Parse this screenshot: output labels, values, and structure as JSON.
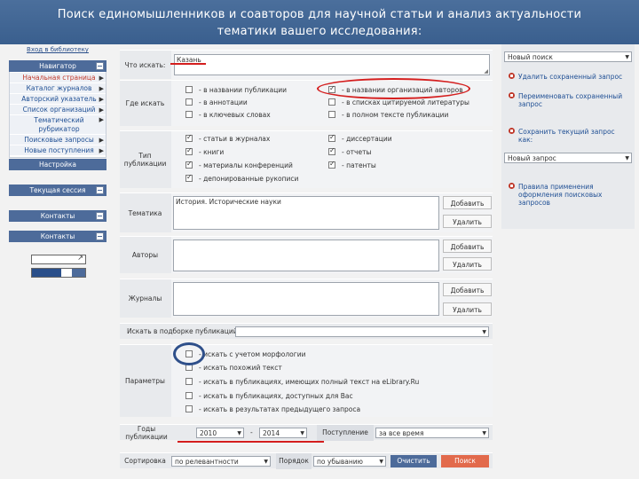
{
  "banner": {
    "line1": "Поиск единомышленников и соавторов для научной статьи и анализ актуальности",
    "line2": "тематики вашего исследования:"
  },
  "sidebar": {
    "top_link": "Вход в библиотеку",
    "nav_header": "Навигатор",
    "nav_items": [
      {
        "label": "Начальная страница"
      },
      {
        "label": "Каталог журналов"
      },
      {
        "label": "Авторский указатель"
      },
      {
        "label": "Список организаций"
      },
      {
        "label": "Тематический рубрикатор"
      },
      {
        "label": "Поисковые запросы"
      },
      {
        "label": "Новые поступления"
      }
    ],
    "settings": "Настройка",
    "panels": [
      "Текущая сессия",
      "Контакты",
      "Контакты"
    ]
  },
  "form": {
    "what": {
      "label": "Что искать:",
      "value": "Казань"
    },
    "where": {
      "label": "Где искать",
      "options": [
        {
          "label": "- в названии публикации",
          "checked": false
        },
        {
          "label": "- в аннотации",
          "checked": false
        },
        {
          "label": "- в ключевых словах",
          "checked": false
        },
        {
          "label": "- в названии организаций авторов",
          "checked": true
        },
        {
          "label": "- в списках цитируемой литературы",
          "checked": false
        },
        {
          "label": "- в полном тексте публикации",
          "checked": false
        }
      ]
    },
    "type": {
      "label": "Тип публикации",
      "options": [
        {
          "label": "- статьи в журналах",
          "checked": true
        },
        {
          "label": "- книги",
          "checked": true
        },
        {
          "label": "- материалы конференций",
          "checked": true
        },
        {
          "label": "- депонированные рукописи",
          "checked": true
        },
        {
          "label": "- диссертации",
          "checked": true
        },
        {
          "label": "- отчеты",
          "checked": true
        },
        {
          "label": "- патенты",
          "checked": true
        }
      ]
    },
    "topic": {
      "label": "Тематика",
      "value": "История. Исторические науки",
      "add": "Добавить",
      "remove": "Удалить"
    },
    "authors": {
      "label": "Авторы",
      "add": "Добавить",
      "remove": "Удалить"
    },
    "journal": {
      "label": "Журналы",
      "add": "Добавить",
      "remove": "Удалить"
    },
    "collection": {
      "label": "Искать в подборке публикаций"
    },
    "params": {
      "label": "Параметры",
      "options": [
        {
          "label": "- искать с учетом морфологии",
          "checked": false
        },
        {
          "label": "- искать похожий текст",
          "checked": false
        },
        {
          "label": "- искать в публикациях, имеющих полный текст на eLibrary.Ru",
          "checked": false
        },
        {
          "label": "- искать в публикациях, доступных для Вас",
          "checked": false
        },
        {
          "label": "- искать в результатах предыдущего запроса",
          "checked": false
        }
      ]
    },
    "years": {
      "label": "Годы публикации",
      "from": "2010",
      "dash": "-",
      "to": "2014",
      "received_label": "Поступление",
      "received_value": "за все время"
    },
    "sort": {
      "label": "Сортировка",
      "value": "по релевантности",
      "order_label": "Порядок",
      "order_value": "по убыванию",
      "clear": "Очистить",
      "search": "Поиск"
    }
  },
  "right": {
    "query_select": "Новый поиск",
    "items": [
      "Удалить сохраненный запрос",
      "Переименовать сохраненный запрос",
      "Сохранить текущий запрос как:"
    ],
    "name_select": "Новый запрос",
    "help": "Правила применения оформления поисковых запросов"
  },
  "colors": {
    "accent": "#4d6b9a",
    "highlight": "#d41e1e",
    "circle": "#2e4f8a"
  }
}
